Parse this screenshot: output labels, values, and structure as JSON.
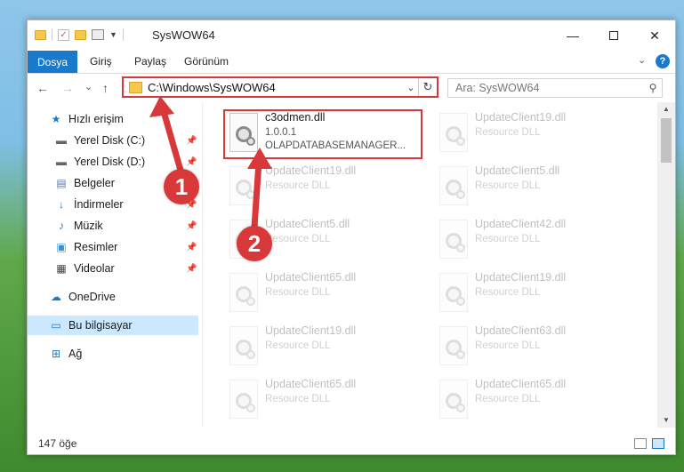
{
  "window": {
    "title": "SysWOW64",
    "controls": {
      "minimize": "—",
      "close": "✕"
    }
  },
  "ribbon": {
    "tabs": [
      {
        "label": "Dosya",
        "active": true
      },
      {
        "label": "Giriş"
      },
      {
        "label": "Paylaş"
      },
      {
        "label": "Görünüm"
      }
    ],
    "help": "?",
    "collapse": "⌄"
  },
  "navbar": {
    "back": "←",
    "forward": "→",
    "recent": "⌄",
    "up": "↑",
    "path": "C:\\Windows\\SysWOW64",
    "dropdown": "⌄",
    "refresh": "↻",
    "search_placeholder": "Ara: SysWOW64"
  },
  "sidebar": {
    "items": [
      {
        "label": "Hızlı erişim",
        "icon": "star-icon"
      },
      {
        "label": "Yerel Disk (C:)",
        "icon": "drive-icon",
        "pinned": true
      },
      {
        "label": "Yerel Disk (D:)",
        "icon": "drive-icon",
        "pinned": true
      },
      {
        "label": "Belgeler",
        "icon": "document-icon",
        "pinned": true
      },
      {
        "label": "İndirmeler",
        "icon": "download-icon",
        "pinned": true
      },
      {
        "label": "Müzik",
        "icon": "music-icon",
        "pinned": true
      },
      {
        "label": "Resimler",
        "icon": "pictures-icon",
        "pinned": true
      },
      {
        "label": "Videolar",
        "icon": "video-icon",
        "pinned": true
      },
      {
        "label": "OneDrive",
        "icon": "cloud-icon"
      },
      {
        "label": "Bu bilgisayar",
        "icon": "computer-icon",
        "selected": true
      },
      {
        "label": "Ağ",
        "icon": "network-icon"
      }
    ]
  },
  "files": [
    {
      "name": "c3odmen.dll",
      "line2": "1.0.0.1",
      "line3": "OLAPDATABASEMANAGER...",
      "highlighted": true
    },
    {
      "name": "UpdateClient19.dll",
      "line2": "Resource DLL"
    },
    {
      "name": "UpdateClient19.dll",
      "line2": "Resource DLL"
    },
    {
      "name": "UpdateClient5.dll",
      "line2": "Resource DLL"
    },
    {
      "name": "UpdateClient5.dll",
      "line2": "Resource DLL"
    },
    {
      "name": "UpdateClient42.dll",
      "line2": "Resource DLL"
    },
    {
      "name": "UpdateClient65.dll",
      "line2": "Resource DLL"
    },
    {
      "name": "UpdateClient19.dll",
      "line2": "Resource DLL"
    },
    {
      "name": "UpdateClient19.dll",
      "line2": "Resource DLL"
    },
    {
      "name": "UpdateClient63.dll",
      "line2": "Resource DLL"
    },
    {
      "name": "UpdateClient65.dll",
      "line2": "Resource DLL"
    },
    {
      "name": "UpdateClient65.dll",
      "line2": "Resource DLL"
    }
  ],
  "status": {
    "count": "147 öğe"
  },
  "callouts": [
    {
      "label": "1"
    },
    {
      "label": "2"
    }
  ],
  "colors": {
    "accent": "#1979ca",
    "highlight": "#d9383a",
    "selected_bg": "#cce8ff",
    "folder": "#f5c84c"
  }
}
